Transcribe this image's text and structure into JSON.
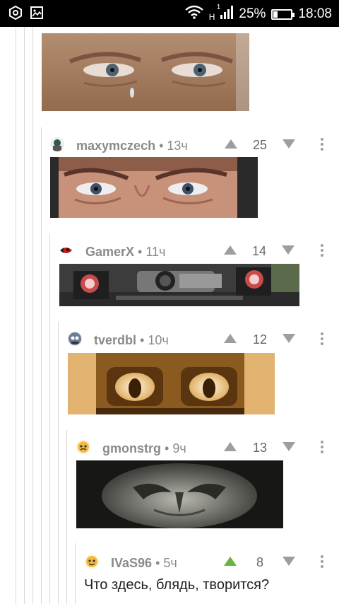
{
  "status_bar": {
    "network_type": "H",
    "network_sup": "1",
    "battery_percent": "25%",
    "battery_level": 0.25,
    "time": "18:08"
  },
  "comments": [
    {
      "author": "maxymczech",
      "time": "13ч",
      "score": "25",
      "upvoted": false
    },
    {
      "author": "GamerX",
      "time": "11ч",
      "score": "14",
      "upvoted": false
    },
    {
      "author": "tverdbl",
      "time": "10ч",
      "score": "12",
      "upvoted": false
    },
    {
      "author": "gmonstrg",
      "time": "9ч",
      "score": "13",
      "upvoted": false
    },
    {
      "author": "IVaS96",
      "time": "5ч",
      "score": "8",
      "upvoted": true,
      "text": "Что здесь, блядь, творится?"
    }
  ],
  "colors": {
    "upvote_active": "#6db33f",
    "vote_inactive": "#9e9e9e",
    "author_text": "#8a8a8a"
  }
}
